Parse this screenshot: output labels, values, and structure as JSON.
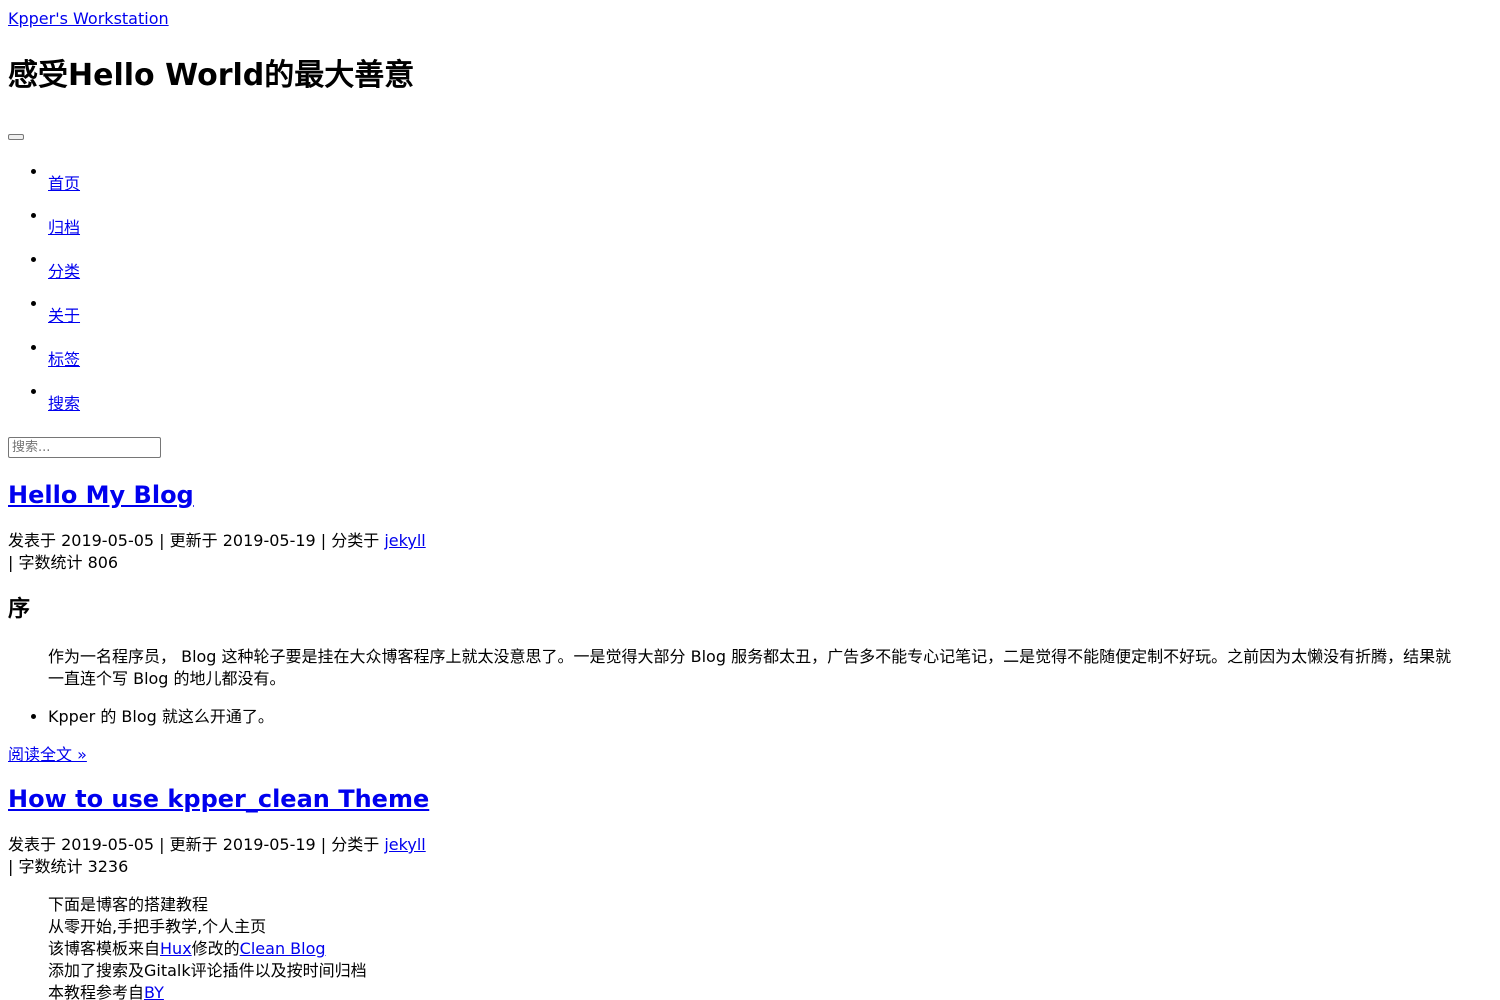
{
  "header": {
    "site_title": "Kpper's Workstation",
    "tagline": "感受Hello World的最大善意"
  },
  "nav": {
    "items": [
      {
        "label": "首页"
      },
      {
        "label": "归档"
      },
      {
        "label": "分类"
      },
      {
        "label": "关于"
      },
      {
        "label": "标签"
      },
      {
        "label": "搜索"
      }
    ]
  },
  "search": {
    "placeholder": "搜索..."
  },
  "posts": [
    {
      "title": "Hello My Blog",
      "meta_prefix": "发表于 2019-05-05 | 更新于 2019-05-19 | 分类于 ",
      "category": "jekyll",
      "word_count": "| 字数统计 806",
      "section_heading": "序",
      "quote": "作为一名程序员， Blog 这种轮子要是挂在大众博客程序上就太没意思了。一是觉得大部分 Blog 服务都太丑，广告多不能专心记笔记，二是觉得不能随便定制不好玩。之前因为太懒没有折腾，结果就一直连个写 Blog 的地儿都没有。",
      "bullet": "Kpper 的 Blog 就这么开通了。",
      "read_more": "阅读全文 »"
    },
    {
      "title": "How to use kpper_clean Theme",
      "meta_prefix": "发表于 2019-05-05 | 更新于 2019-05-19 | 分类于 ",
      "category": "jekyll",
      "word_count": "| 字数统计 3236",
      "intro_line1": "下面是博客的搭建教程",
      "intro_line2": "从零开始,手把手教学,个人主页",
      "intro_line3_a": "该博客模板来自",
      "intro_line3_link1": "Hux",
      "intro_line3_b": "修改的",
      "intro_line3_link2": "Clean Blog",
      "intro_line4": "添加了搜索及Gitalk评论插件以及按时间归档",
      "intro_line5_a": "本教程参考自",
      "intro_line5_link": "BY"
    }
  ],
  "colors": {
    "link": "#0000ee",
    "text": "#000000",
    "background": "#ffffff"
  }
}
